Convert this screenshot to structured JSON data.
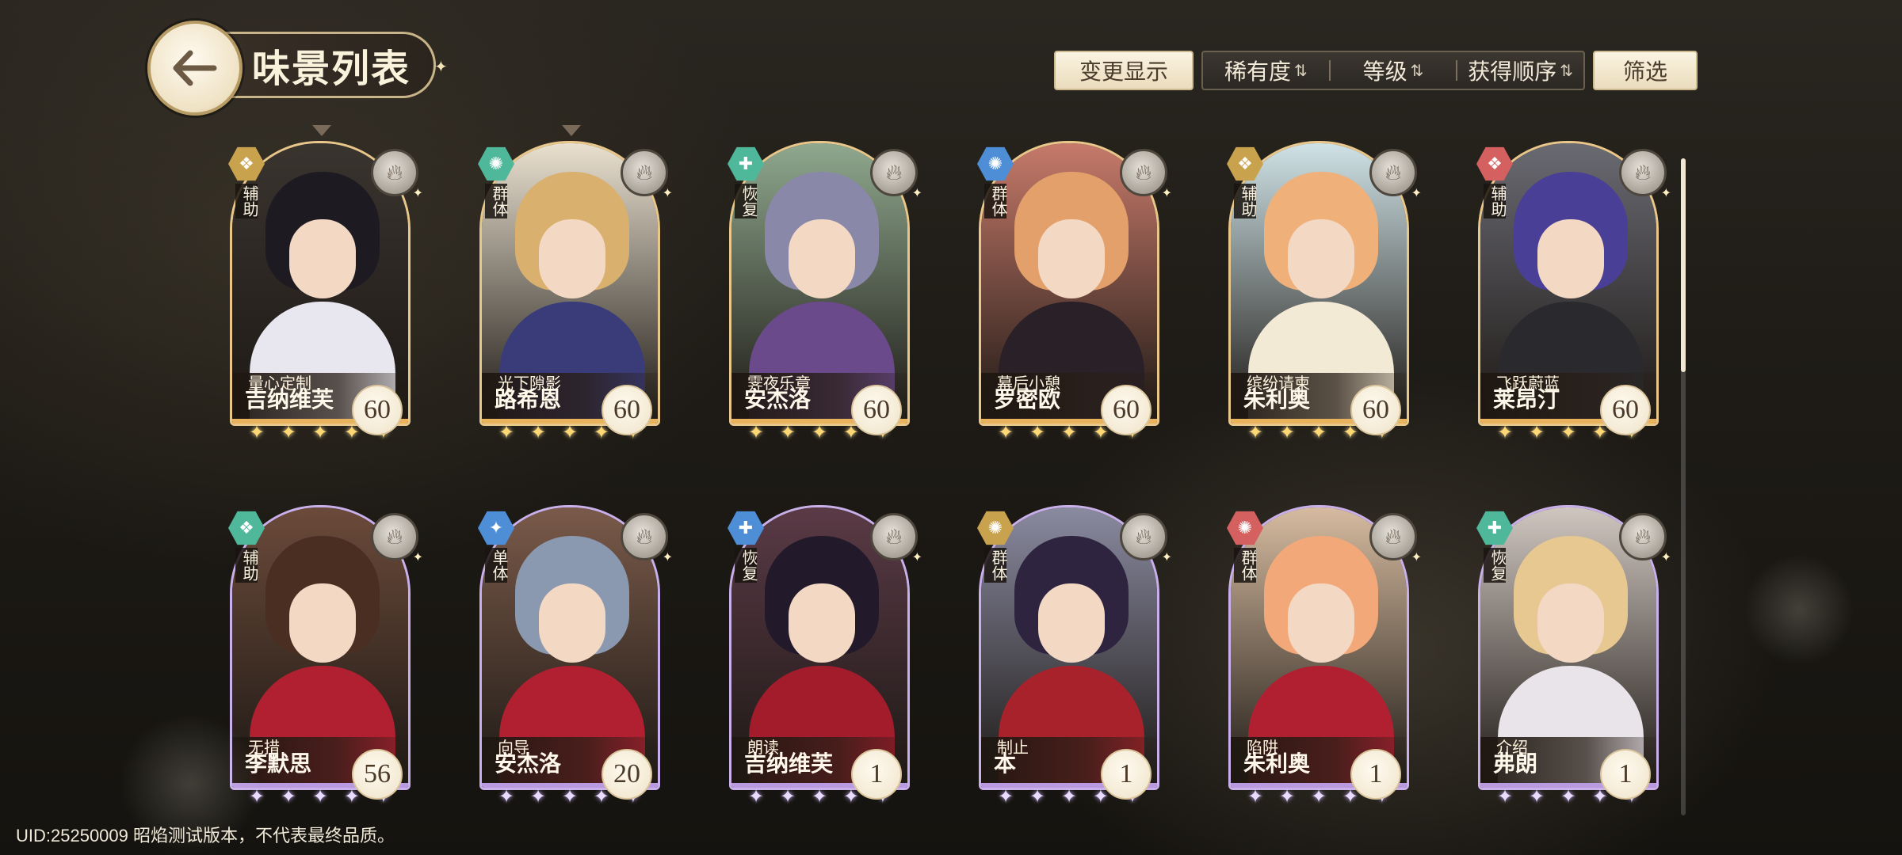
{
  "header": {
    "title": "味景列表",
    "back_icon": "arrow-left-icon"
  },
  "toolbar": {
    "change_display": "变更显示",
    "sort_options": [
      {
        "label": "稀有度",
        "icon": "sort-arrows-icon"
      },
      {
        "label": "等级",
        "icon": "sort-arrows-icon"
      },
      {
        "label": "获得顺序",
        "icon": "sort-arrows-icon"
      }
    ],
    "filter": "筛选"
  },
  "colors": {
    "gold_frame": "#e9c78a",
    "purple_frame": "#c9b0ea",
    "role_assist": "#c9a24e",
    "role_group": "#4fb79a",
    "role_heal": "#5aa88a",
    "role_single": "#4d8ed6",
    "role_red": "#d46060"
  },
  "cards": [
    {
      "subtitle": "量心定制",
      "name": "吉纳维芙",
      "level": "60",
      "role": "辅助",
      "rarity": "gold",
      "badge_color": "#c9a24e",
      "hair": "#1d1a22",
      "outfit": "#e8e6ee",
      "bg": "#3a342f",
      "selected": true
    },
    {
      "subtitle": "光下隙影",
      "name": "路希恩",
      "level": "60",
      "role": "群体",
      "rarity": "gold",
      "badge_color": "#4fb79a",
      "hair": "#d9b06e",
      "outfit": "#3a3c7a",
      "bg": "#e9e0cf",
      "selected": true
    },
    {
      "subtitle": "霁夜乐章",
      "name": "安杰洛",
      "level": "60",
      "role": "恢复",
      "rarity": "gold",
      "badge_color": "#4fb79a",
      "hair": "#8a88a8",
      "outfit": "#6a4a8a",
      "bg": "#8fa88e",
      "selected": false
    },
    {
      "subtitle": "幕后小憩",
      "name": "罗密欧",
      "level": "60",
      "role": "群体",
      "rarity": "gold",
      "badge_color": "#4d8ed6",
      "hair": "#e4a06a",
      "outfit": "#2a2028",
      "bg": "#c67a6a",
      "selected": false
    },
    {
      "subtitle": "缤纷请柬",
      "name": "朱利奥",
      "level": "60",
      "role": "辅助",
      "rarity": "gold",
      "badge_color": "#c9a24e",
      "hair": "#f0b07a",
      "outfit": "#f3ead6",
      "bg": "#cfe2e6",
      "selected": false
    },
    {
      "subtitle": "飞跃蔚蓝",
      "name": "莱昂汀",
      "level": "60",
      "role": "辅助",
      "rarity": "gold",
      "badge_color": "#d46060",
      "hair": "#4a3f96",
      "outfit": "#2a2a2e",
      "bg": "#6a6a72",
      "selected": false
    },
    {
      "subtitle": "无措",
      "name": "李默思",
      "level": "56",
      "role": "辅助",
      "rarity": "purple",
      "badge_color": "#4fb79a",
      "hair": "#4a2e22",
      "outfit": "#b02030",
      "bg": "#6b4a3a",
      "selected": false
    },
    {
      "subtitle": "向导",
      "name": "安杰洛",
      "level": "20",
      "role": "单体",
      "rarity": "purple",
      "badge_color": "#4d8ed6",
      "hair": "#8a98b0",
      "outfit": "#b02030",
      "bg": "#7a5a4a",
      "selected": false
    },
    {
      "subtitle": "朗读",
      "name": "吉纳维芙",
      "level": "1",
      "role": "恢复",
      "rarity": "purple",
      "badge_color": "#4d8ed6",
      "hair": "#221a2a",
      "outfit": "#a21c2c",
      "bg": "#5a3a46",
      "selected": false
    },
    {
      "subtitle": "制止",
      "name": "本",
      "level": "1",
      "role": "群体",
      "rarity": "purple",
      "badge_color": "#c9a24e",
      "hair": "#2e2440",
      "outfit": "#a8222c",
      "bg": "#8a8aa0",
      "selected": false
    },
    {
      "subtitle": "陷阱",
      "name": "朱利奥",
      "level": "1",
      "role": "群体",
      "rarity": "purple",
      "badge_color": "#d46060",
      "hair": "#f2a878",
      "outfit": "#b02030",
      "bg": "#d6bba0",
      "selected": false
    },
    {
      "subtitle": "介绍",
      "name": "弗朗",
      "level": "1",
      "role": "恢复",
      "rarity": "purple",
      "badge_color": "#4fb79a",
      "hair": "#e6c890",
      "outfit": "#e9e4ea",
      "bg": "#d0c6c0",
      "selected": false
    }
  ],
  "footer": {
    "uid_text": "UID:25250009  昭焰测试版本，不代表最终品质。"
  }
}
